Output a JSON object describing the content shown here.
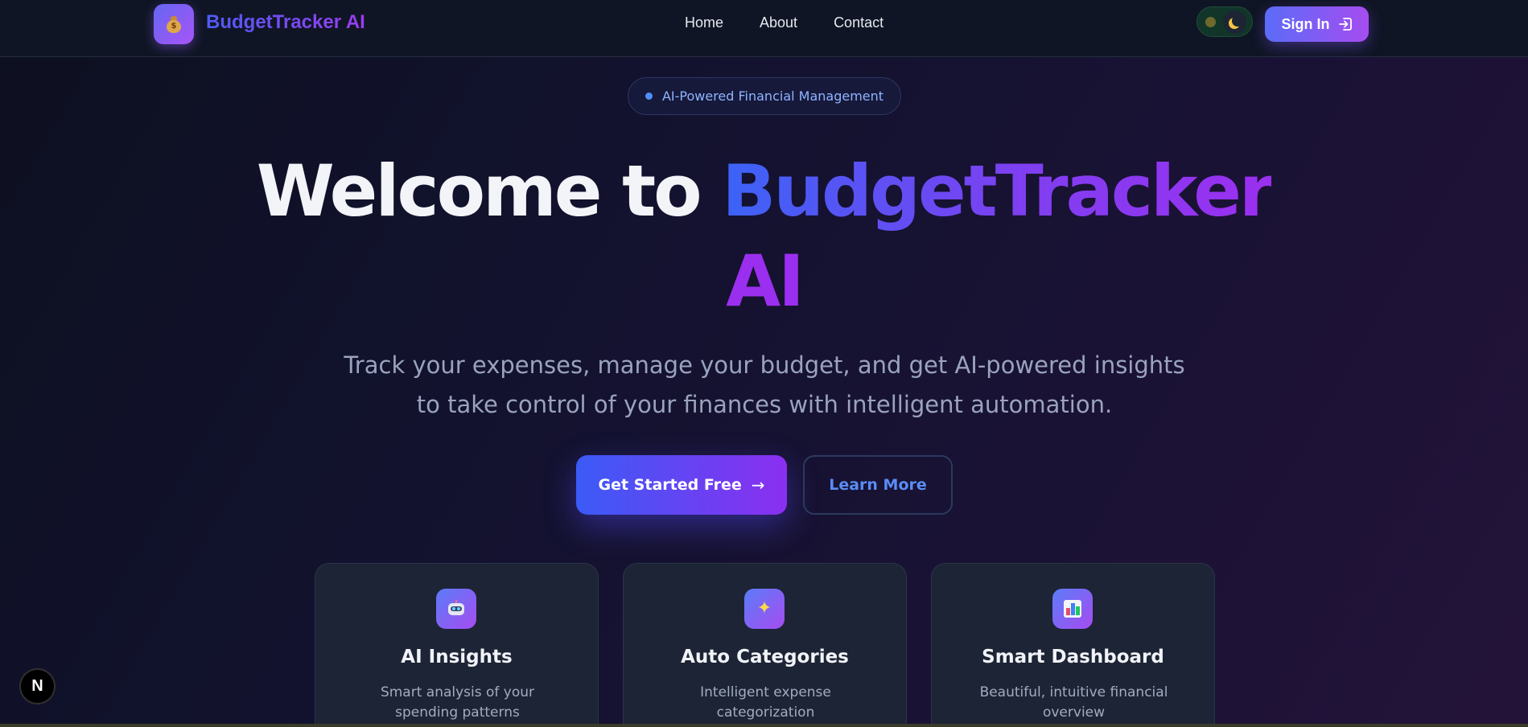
{
  "nav": {
    "brand": "BudgetTracker AI",
    "logo_icon": "money-bag-icon",
    "links": [
      "Home",
      "About",
      "Contact"
    ],
    "theme_toggle_icon": "moon-icon",
    "signin_label": "Sign In",
    "signin_icon": "sign-in-icon"
  },
  "hero": {
    "badge": "AI-Powered Financial Management",
    "title_prefix": "Welcome to ",
    "title_highlight": "BudgetTracker",
    "title_line2": "AI",
    "subtitle_line1": "Track your expenses, manage your budget, and get AI-powered insights",
    "subtitle_line2": "to take control of your finances with intelligent automation.",
    "primary_cta": "Get Started Free",
    "primary_cta_arrow": "→",
    "secondary_cta": "Learn More"
  },
  "features": [
    {
      "icon": "robot-icon",
      "title": "AI Insights",
      "description": "Smart analysis of your spending patterns"
    },
    {
      "icon": "sparkles-icon",
      "title": "Auto Categories",
      "description": "Intelligent expense categorization"
    },
    {
      "icon": "bar-chart-icon",
      "title": "Smart Dashboard",
      "description": "Beautiful, intuitive financial overview"
    }
  ],
  "floating_badge": "N",
  "colors": {
    "accent_blue": "#3b5bf6",
    "accent_purple": "#9b2ff0",
    "nav_bg": "#0f1524",
    "card_bg": "#1c2435"
  }
}
